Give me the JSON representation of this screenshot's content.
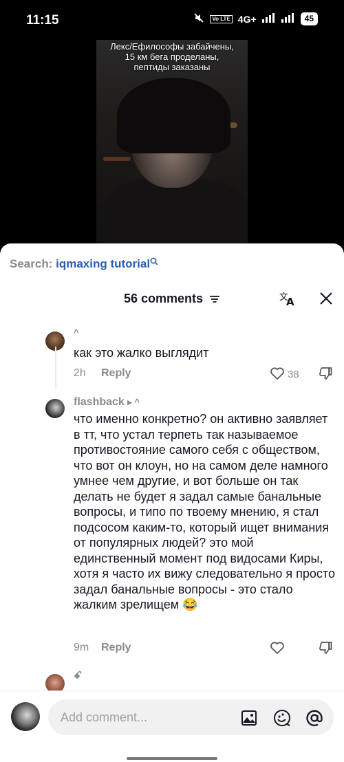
{
  "status_bar": {
    "time": "11:15",
    "network": "4G+",
    "battery": "45",
    "volte": "Vo LTE"
  },
  "video": {
    "caption": "Лекс/Ефилософы забайчены, 15 км бега проделаны, пептиды заказаны"
  },
  "search": {
    "label": "Search:",
    "query": "iqmaxing tutorial"
  },
  "comments_header": {
    "title": "56 comments"
  },
  "comments": [
    {
      "username": "^",
      "text": "как это жалко выглядит",
      "time": "2h",
      "reply_label": "Reply",
      "likes": "38"
    },
    {
      "username": "flashback",
      "username_suffix": "▸ ^",
      "text": "что именно конкретно? он активно заявляет в тт, что устал терпеть так называемое противостояние самого себя с обществом, что вот он клоун, но на самом деле намного умнее чем другие, и вот больше он так делать не будет я задал самые банальные вопросы, и типо по твоему мнению, я стал подсосом каким-то, который ищет внимания от популярных людей? это мой единственный момент под видосами Киры, хотя я часто их вижу следовательно я просто задал банальные вопросы - это стало жалким зрелищем 😂",
      "time": "9m",
      "reply_label": "Reply",
      "likes": ""
    },
    {
      "username": "ꗃ",
      "text": ""
    }
  ],
  "composer": {
    "placeholder": "Add comment..."
  },
  "colors": {
    "accent_link": "#2b5db8",
    "muted": "#8a8a8a",
    "text": "#161823"
  }
}
